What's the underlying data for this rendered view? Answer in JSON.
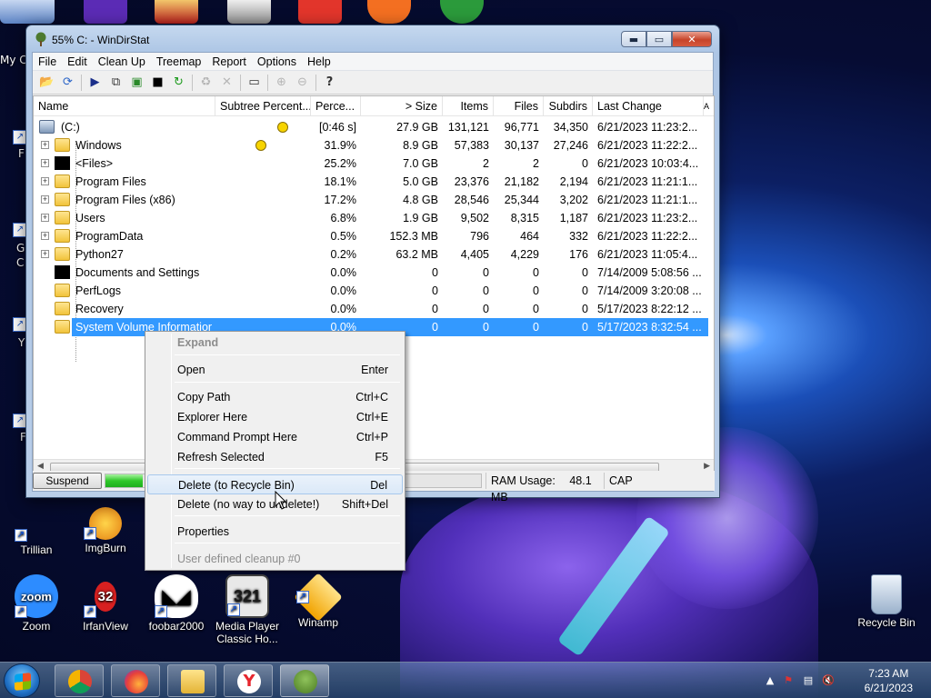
{
  "window": {
    "title": "55% C: - WinDirStat"
  },
  "menu": [
    "File",
    "Edit",
    "Clean Up",
    "Treemap",
    "Report",
    "Options",
    "Help"
  ],
  "toolbar_icons": [
    "open-icon",
    "refresh-icon",
    "play-icon",
    "copy-icon",
    "explorer-icon",
    "cmd-icon",
    "refresh-selected-icon",
    "recycle-icon",
    "delete-icon",
    "new-folder-icon",
    "zoom-in-icon",
    "zoom-out-icon",
    "help-icon"
  ],
  "columns": {
    "name": "Name",
    "subtree": "Subtree Percent...",
    "percent": "Perce...",
    "size": "> Size",
    "items": "Items",
    "files": "Files",
    "subdirs": "Subdirs",
    "last_change": "Last Change",
    "more": "A"
  },
  "rows": [
    {
      "name": "(C:)",
      "percent": "[0:46 s]",
      "size": "27.9 GB",
      "items": "131,121",
      "files": "96,771",
      "subdirs": "34,350",
      "last_change": "6/21/2023  11:23:2..."
    },
    {
      "name": "Windows",
      "percent": "31.9%",
      "size": "8.9 GB",
      "items": "57,383",
      "files": "30,137",
      "subdirs": "27,246",
      "last_change": "6/21/2023  11:22:2..."
    },
    {
      "name": "<Files>",
      "percent": "25.2%",
      "size": "7.0 GB",
      "items": "2",
      "files": "2",
      "subdirs": "0",
      "last_change": "6/21/2023  10:03:4..."
    },
    {
      "name": "Program Files",
      "percent": "18.1%",
      "size": "5.0 GB",
      "items": "23,376",
      "files": "21,182",
      "subdirs": "2,194",
      "last_change": "6/21/2023  11:21:1..."
    },
    {
      "name": "Program Files (x86)",
      "percent": "17.2%",
      "size": "4.8 GB",
      "items": "28,546",
      "files": "25,344",
      "subdirs": "3,202",
      "last_change": "6/21/2023  11:21:1..."
    },
    {
      "name": "Users",
      "percent": "6.8%",
      "size": "1.9 GB",
      "items": "9,502",
      "files": "8,315",
      "subdirs": "1,187",
      "last_change": "6/21/2023  11:23:2..."
    },
    {
      "name": "ProgramData",
      "percent": "0.5%",
      "size": "152.3 MB",
      "items": "796",
      "files": "464",
      "subdirs": "332",
      "last_change": "6/21/2023  11:22:2..."
    },
    {
      "name": "Python27",
      "percent": "0.2%",
      "size": "63.2 MB",
      "items": "4,405",
      "files": "4,229",
      "subdirs": "176",
      "last_change": "6/21/2023  11:05:4..."
    },
    {
      "name": "Documents and Settings",
      "percent": "0.0%",
      "size": "0",
      "items": "0",
      "files": "0",
      "subdirs": "0",
      "last_change": "7/14/2009  5:08:56 ..."
    },
    {
      "name": "PerfLogs",
      "percent": "0.0%",
      "size": "0",
      "items": "0",
      "files": "0",
      "subdirs": "0",
      "last_change": "7/14/2009  3:20:08 ..."
    },
    {
      "name": "Recovery",
      "percent": "0.0%",
      "size": "0",
      "items": "0",
      "files": "0",
      "subdirs": "0",
      "last_change": "5/17/2023  8:22:12 ..."
    },
    {
      "name": "System Volume Information",
      "percent": "0.0%",
      "size": "0",
      "items": "0",
      "files": "0",
      "subdirs": "0",
      "last_change": "5/17/2023  8:32:54 ..."
    }
  ],
  "status": {
    "suspend": "Suspend",
    "progress": 0.1,
    "ram_label": "RAM Usage:",
    "ram_value": "48.1 MB",
    "cap": "CAP"
  },
  "context_menu": [
    {
      "label": "Expand",
      "accel": "",
      "disabled": true,
      "bold": true
    },
    {
      "label": "Open",
      "accel": "Enter"
    },
    {
      "label": "Copy Path",
      "accel": "Ctrl+C"
    },
    {
      "label": "Explorer Here",
      "accel": "Ctrl+E"
    },
    {
      "label": "Command Prompt Here",
      "accel": "Ctrl+P"
    },
    {
      "label": "Refresh Selected",
      "accel": "F5"
    },
    {
      "label": "Delete (to Recycle Bin)",
      "accel": "Del",
      "highlighted": true
    },
    {
      "label": "Delete (no way to undelete!)",
      "accel": "Shift+Del"
    },
    {
      "label": "Properties",
      "accel": ""
    },
    {
      "label": "User defined cleanup #0",
      "accel": "",
      "disabled": true
    }
  ],
  "desktop_icons": [
    {
      "label": "Trillian"
    },
    {
      "label": "ImgBurn"
    },
    {
      "label": "Zoom"
    },
    {
      "label": "IrfanView"
    },
    {
      "label": "foobar2000"
    },
    {
      "label": "Media Player Classic Ho..."
    },
    {
      "label": "Winamp"
    },
    {
      "label": "Recycle Bin"
    }
  ],
  "edge_labels": [
    "My C",
    "F",
    "G",
    "C",
    "Y",
    "F"
  ],
  "icon_texts": {
    "zoom": "zoom",
    "irfanview": "32",
    "mpc": "321"
  },
  "taskbar": {
    "time": "7:23 AM",
    "date": "6/21/2023"
  }
}
